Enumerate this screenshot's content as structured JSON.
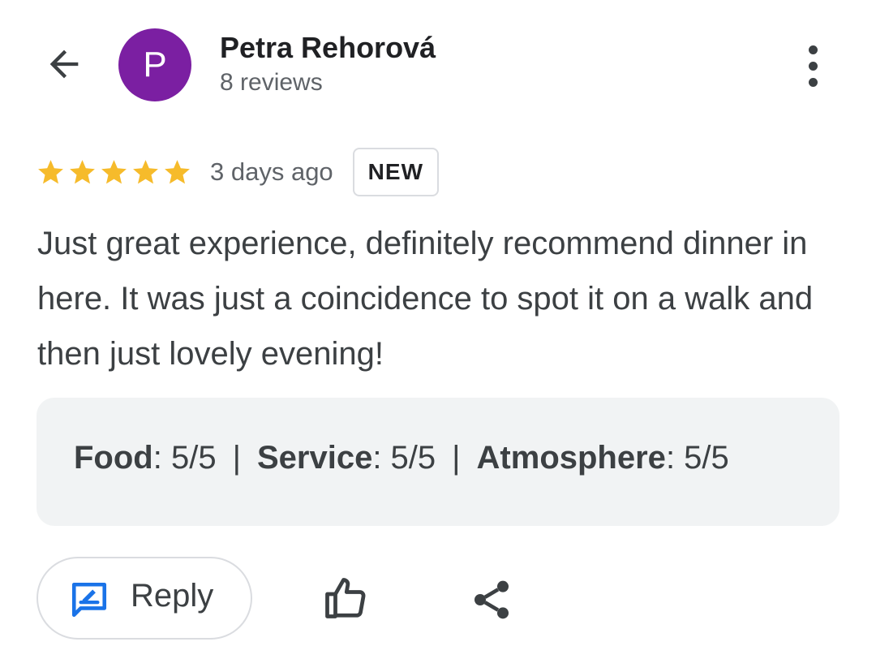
{
  "header": {
    "back_icon": "arrow-back-icon",
    "avatar_letter": "P",
    "avatar_color": "#7b1fa2",
    "reviewer_name": "Petra Rehorová",
    "review_count": "8 reviews",
    "more_icon": "more-vert-icon"
  },
  "review": {
    "rating": 5,
    "max_rating": 5,
    "star_color": "#f6bb2b",
    "time_ago": "3 days ago",
    "badge": "NEW",
    "text": "Just great experience, definitely recommend dinner in here. It was just a coincidence to spot it on a walk and then just lovely evening!"
  },
  "ratings": [
    {
      "category": "Food",
      "value": "5/5"
    },
    {
      "category": "Service",
      "value": "5/5"
    },
    {
      "category": "Atmosphere",
      "value": "5/5"
    }
  ],
  "actions": {
    "reply_label": "Reply",
    "reply_icon": "reply-icon",
    "reply_icon_color": "#1a73e8",
    "like_icon": "thumb-up-icon",
    "share_icon": "share-icon"
  }
}
